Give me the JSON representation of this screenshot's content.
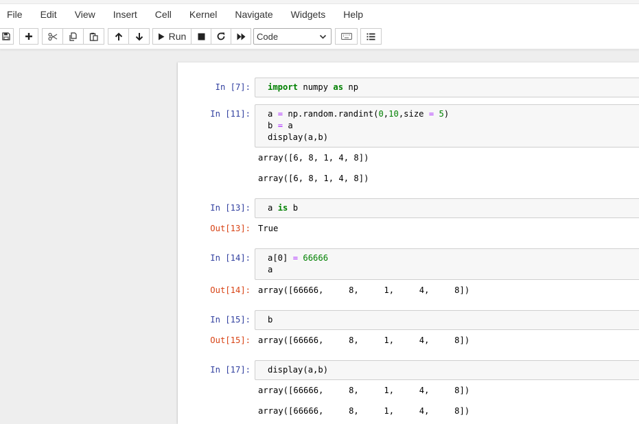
{
  "menu": [
    "File",
    "Edit",
    "View",
    "Insert",
    "Cell",
    "Kernel",
    "Navigate",
    "Widgets",
    "Help"
  ],
  "toolbar": {
    "run_label": "Run",
    "cell_type": "Code",
    "icons": [
      "save-icon",
      "plus-icon",
      "cut-icon",
      "copy-icon",
      "paste-icon",
      "arrow-up-icon",
      "arrow-down-icon",
      "play-icon",
      "stop-icon",
      "restart-icon",
      "fast-forward-icon",
      "keyboard-icon",
      "list-icon"
    ]
  },
  "cells": [
    {
      "in_prompt": "In [7]:",
      "code": [
        [
          {
            "t": "import",
            "c": "kw"
          },
          {
            "t": " numpy "
          },
          {
            "t": "as",
            "c": "kw"
          },
          {
            "t": " np"
          }
        ]
      ],
      "outputs": []
    },
    {
      "in_prompt": "In [11]:",
      "code": [
        [
          {
            "t": "a "
          },
          {
            "t": "=",
            "c": "op"
          },
          {
            "t": " np.random.randint("
          },
          {
            "t": "0",
            "c": "num"
          },
          {
            "t": ","
          },
          {
            "t": "10",
            "c": "num"
          },
          {
            "t": ",size "
          },
          {
            "t": "=",
            "c": "op"
          },
          {
            "t": " "
          },
          {
            "t": "5",
            "c": "num"
          },
          {
            "t": ")"
          }
        ],
        [
          {
            "t": "b "
          },
          {
            "t": "=",
            "c": "op"
          },
          {
            "t": " a"
          }
        ],
        [
          {
            "t": "display(a,b)"
          }
        ]
      ],
      "outputs": [
        {
          "prompt": "",
          "text": "array([6, 8, 1, 4, 8])"
        },
        {
          "prompt": "",
          "text": "array([6, 8, 1, 4, 8])"
        }
      ]
    },
    {
      "in_prompt": "In [13]:",
      "code": [
        [
          {
            "t": "a "
          },
          {
            "t": "is",
            "c": "kw"
          },
          {
            "t": " b"
          }
        ]
      ],
      "outputs": [
        {
          "prompt": "Out[13]:",
          "text": "True"
        }
      ]
    },
    {
      "in_prompt": "In [14]:",
      "code": [
        [
          {
            "t": "a[0] "
          },
          {
            "t": "=",
            "c": "op"
          },
          {
            "t": " "
          },
          {
            "t": "66666",
            "c": "num"
          }
        ],
        [
          {
            "t": "a"
          }
        ]
      ],
      "outputs": [
        {
          "prompt": "Out[14]:",
          "text": "array([66666,     8,     1,     4,     8])"
        }
      ]
    },
    {
      "in_prompt": "In [15]:",
      "code": [
        [
          {
            "t": "b"
          }
        ]
      ],
      "outputs": [
        {
          "prompt": "Out[15]:",
          "text": "array([66666,     8,     1,     4,     8])"
        }
      ]
    },
    {
      "in_prompt": "In [17]:",
      "code": [
        [
          {
            "t": "display(a,b)"
          }
        ]
      ],
      "outputs": [
        {
          "prompt": "",
          "text": "array([66666,     8,     1,     4,     8])"
        },
        {
          "prompt": "",
          "text": "array([66666,     8,     1,     4,     8])"
        }
      ]
    }
  ]
}
